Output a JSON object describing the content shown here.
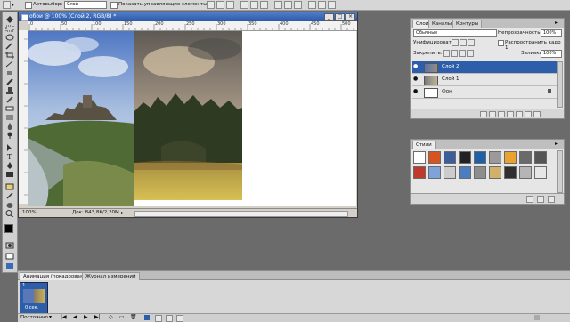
{
  "options_bar": {
    "autoselect_label": "Автовыбор:",
    "autoselect_value": "Слой",
    "show_controls_label": "Показать управляющие элементы"
  },
  "document": {
    "title": "обои @ 100% (Слой 2, RGB/8) *",
    "ruler_ticks": [
      "0",
      "50",
      "100",
      "150",
      "200",
      "250",
      "300",
      "350",
      "400",
      "450",
      "500"
    ],
    "zoom": "100%",
    "doc_size": "Док: 843,8K/2,20M"
  },
  "layers_panel": {
    "tabs": [
      "Слои",
      "Каналы",
      "Контуры"
    ],
    "blend_mode": "Обычные",
    "opacity_label": "Непрозрачность:",
    "opacity_value": "100%",
    "unify_label": "Унифицировать:",
    "propagate_label": "Распространить кадр 1",
    "lock_label": "Закрепить:",
    "fill_label": "Заливка:",
    "fill_value": "100%",
    "layers": [
      {
        "name": "Слой 2",
        "selected": true
      },
      {
        "name": "Слой 1",
        "selected": false
      },
      {
        "name": "Фон",
        "selected": false
      }
    ]
  },
  "styles_panel": {
    "tab": "Стили",
    "swatch_colors": [
      "#ffffff",
      "#d9531e",
      "#3b5e9a",
      "#222222",
      "#1d5fa8",
      "#9a9a9a",
      "#e9a22d",
      "#6a6a6a",
      "#555555",
      "#c0392b",
      "#7da3d8",
      "#cccccc",
      "#4a7ec0",
      "#8e8e8e",
      "#d0b06a",
      "#2f2f2f",
      "#b5b5b5",
      "#e6e6e6"
    ]
  },
  "animation_panel": {
    "tabs": [
      "Анимация (покадровая)",
      "Журнал измерений"
    ],
    "frame_number": "1",
    "frame_time": "0 сек.",
    "loop_value": "Постоянно"
  },
  "colors": {
    "title_bar": "#2c58a8",
    "selected_layer": "#2d5ea9",
    "workspace": "#6b6b6b"
  }
}
